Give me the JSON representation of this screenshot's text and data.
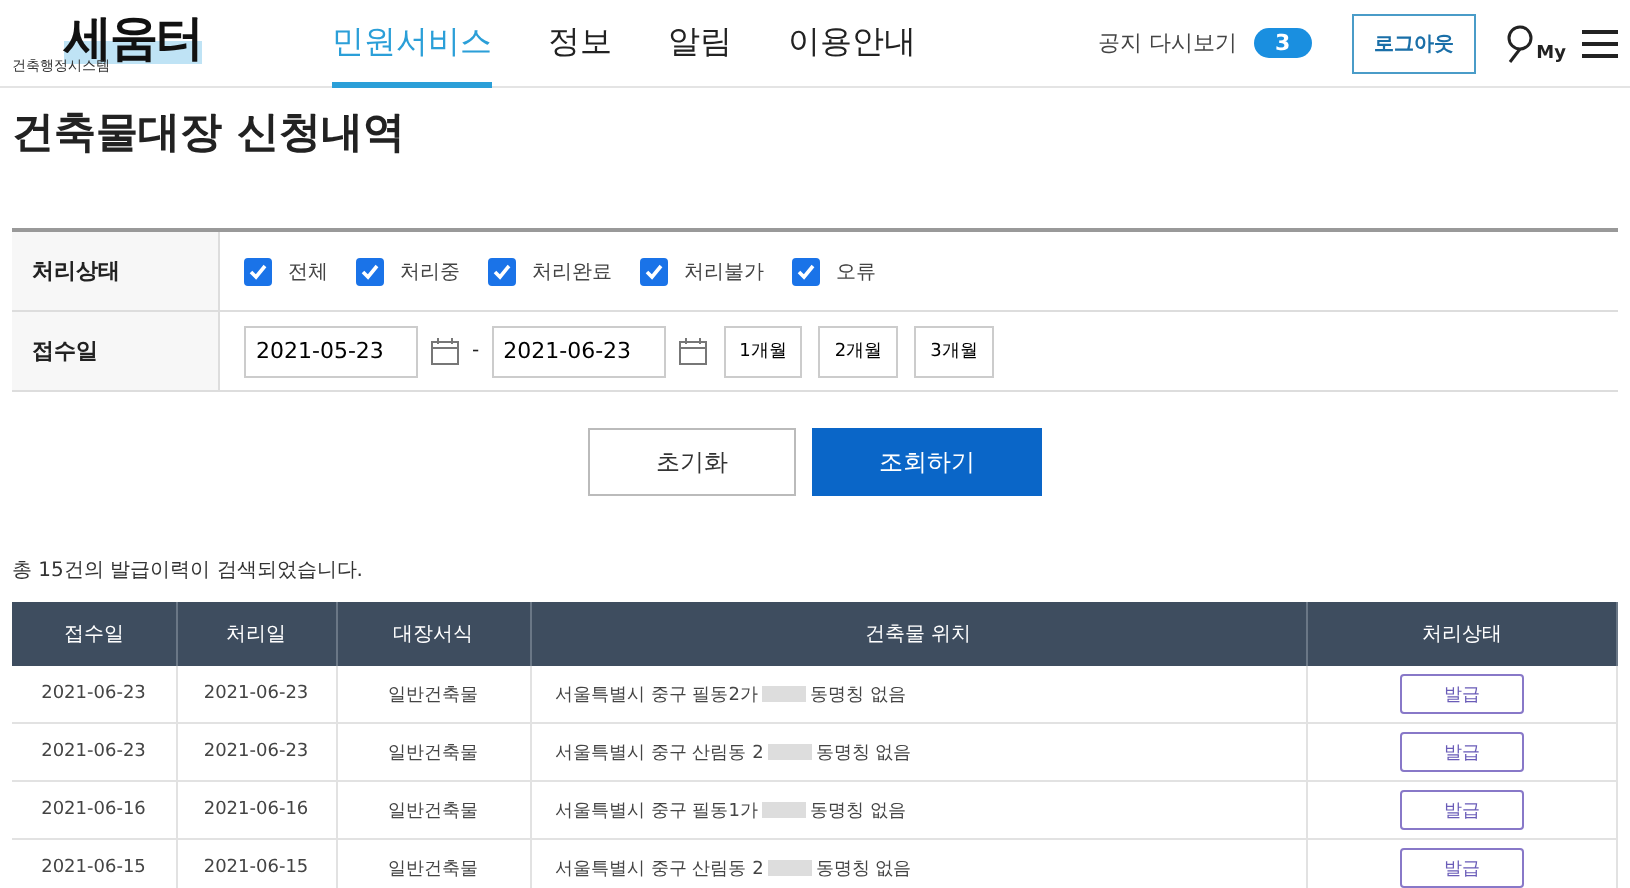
{
  "header": {
    "logo": {
      "name": "세움터",
      "subtitle": "건축행정시스템"
    },
    "nav": [
      {
        "label": "민원서비스",
        "selected": true
      },
      {
        "label": "정보",
        "selected": false
      },
      {
        "label": "알림",
        "selected": false
      },
      {
        "label": "이용안내",
        "selected": false
      }
    ],
    "notice": {
      "label": "공지 다시보기",
      "count": "3"
    },
    "logout": "로그아웃",
    "my_label": "My"
  },
  "title": "건축물대장 신청내역",
  "filter": {
    "status": {
      "label": "처리상태",
      "options": [
        {
          "label": "전체",
          "checked": true
        },
        {
          "label": "처리중",
          "checked": true
        },
        {
          "label": "처리완료",
          "checked": true
        },
        {
          "label": "처리불가",
          "checked": true
        },
        {
          "label": "오류",
          "checked": true
        }
      ]
    },
    "date": {
      "label": "접수일",
      "from": "2021-05-23",
      "to": "2021-06-23",
      "separator": "-",
      "periods": [
        "1개월",
        "2개월",
        "3개월"
      ]
    }
  },
  "actions": {
    "reset": "초기화",
    "search": "조회하기"
  },
  "result_text": "총 15건의 발급이력이 검색되었습니다.",
  "table": {
    "columns": [
      "접수일",
      "처리일",
      "대장서식",
      "건축물 위치",
      "처리상태"
    ],
    "rows": [
      {
        "received": "2021-06-23",
        "processed": "2021-06-23",
        "form": "일반건축물",
        "location": "서울특별시 중구 필동2가",
        "location_suffix": "동명칭 없음",
        "action": "발급"
      },
      {
        "received": "2021-06-23",
        "processed": "2021-06-23",
        "form": "일반건축물",
        "location": "서울특별시 중구 산림동 2",
        "location_suffix": "동명칭 없음",
        "action": "발급"
      },
      {
        "received": "2021-06-16",
        "processed": "2021-06-16",
        "form": "일반건축물",
        "location": "서울특별시 중구 필동1가",
        "location_suffix": "동명칭 없음",
        "action": "발급"
      },
      {
        "received": "2021-06-15",
        "processed": "2021-06-15",
        "form": "일반건축물",
        "location": "서울특별시 중구 산림동 2",
        "location_suffix": "동명칭 없음",
        "action": "발급"
      }
    ]
  }
}
